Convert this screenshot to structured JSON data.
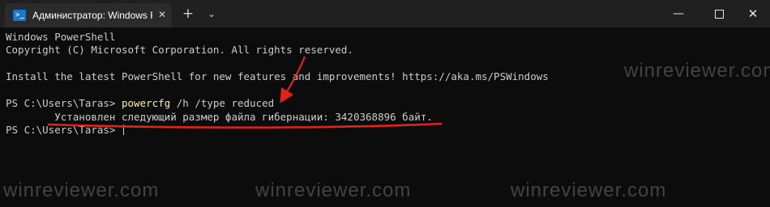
{
  "tab": {
    "title": "Администратор: Windows Pow",
    "icon": "powershell-icon",
    "icon_glyph": ">_",
    "close_glyph": "✕"
  },
  "toolbar": {
    "new_tab_glyph": "+",
    "dropdown_glyph": "⌄"
  },
  "window_controls": {
    "minimize": "—",
    "close": "✕"
  },
  "terminal": {
    "lines": [
      "Windows PowerShell",
      "Copyright (C) Microsoft Corporation. All rights reserved.",
      "Install the latest PowerShell for new features and improvements! https://aka.ms/PSWindows"
    ],
    "prompt1": "PS C:\\Users\\Taras> ",
    "command_name": "powercfg",
    "command_args": " /h /type reduced",
    "output": "        Установлен следующий размер файла гибернации: 3420368896 байт.",
    "prompt2": "PS C:\\Users\\Taras> "
  },
  "watermarks": [
    "winreviewer.com",
    "winreviewer.com",
    "winreviewer.com",
    "winreviewer.com"
  ],
  "colors": {
    "background": "#0c0c0c",
    "titlebar": "#202020",
    "text": "#cccccc",
    "command": "#f9f1a5",
    "annotation": "#e2231a"
  }
}
